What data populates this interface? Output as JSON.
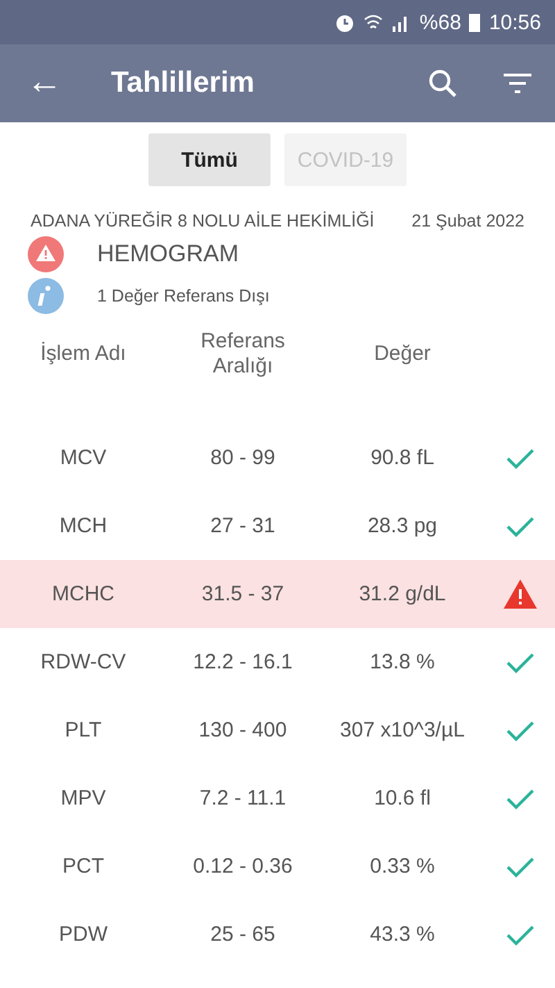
{
  "status_bar": {
    "battery": "%68",
    "time": "10:56"
  },
  "app_bar": {
    "title": "Tahlillerim",
    "back": "←"
  },
  "tabs": [
    {
      "label": "Tümü",
      "selected": true
    },
    {
      "label": "COVID-19",
      "selected": false
    }
  ],
  "report": {
    "institution": "ADANA YÜREĞİR 8 NOLU AİLE HEKİMLİĞİ",
    "date": "21 Şubat 2022",
    "test": "HEMOGRAM",
    "summary": "1 Değer Referans Dışı"
  },
  "columns": [
    "İşlem Adı",
    "Referans\nAralığı",
    "Değer"
  ],
  "rows": [
    {
      "name": "MCV",
      "range": "80 - 99",
      "value": "90.8 fL",
      "out_of_range": false
    },
    {
      "name": "MCH",
      "range": "27 - 31",
      "value": "28.3 pg",
      "out_of_range": false
    },
    {
      "name": "MCHC",
      "range": "31.5 - 37",
      "value": "31.2 g/dL",
      "out_of_range": true
    },
    {
      "name": "RDW-CV",
      "range": "12.2 - 16.1",
      "value": "13.8 %",
      "out_of_range": false
    },
    {
      "name": "PLT",
      "range": "130 - 400",
      "value": "307 x10^3/µL",
      "out_of_range": false
    },
    {
      "name": "MPV",
      "range": "7.2 - 11.1",
      "value": "10.6 fl",
      "out_of_range": false
    },
    {
      "name": "PCT",
      "range": "0.12 - 0.36",
      "value": "0.33 %",
      "out_of_range": false
    },
    {
      "name": "PDW",
      "range": "25 - 65",
      "value": "43.3 %",
      "out_of_range": false
    }
  ]
}
